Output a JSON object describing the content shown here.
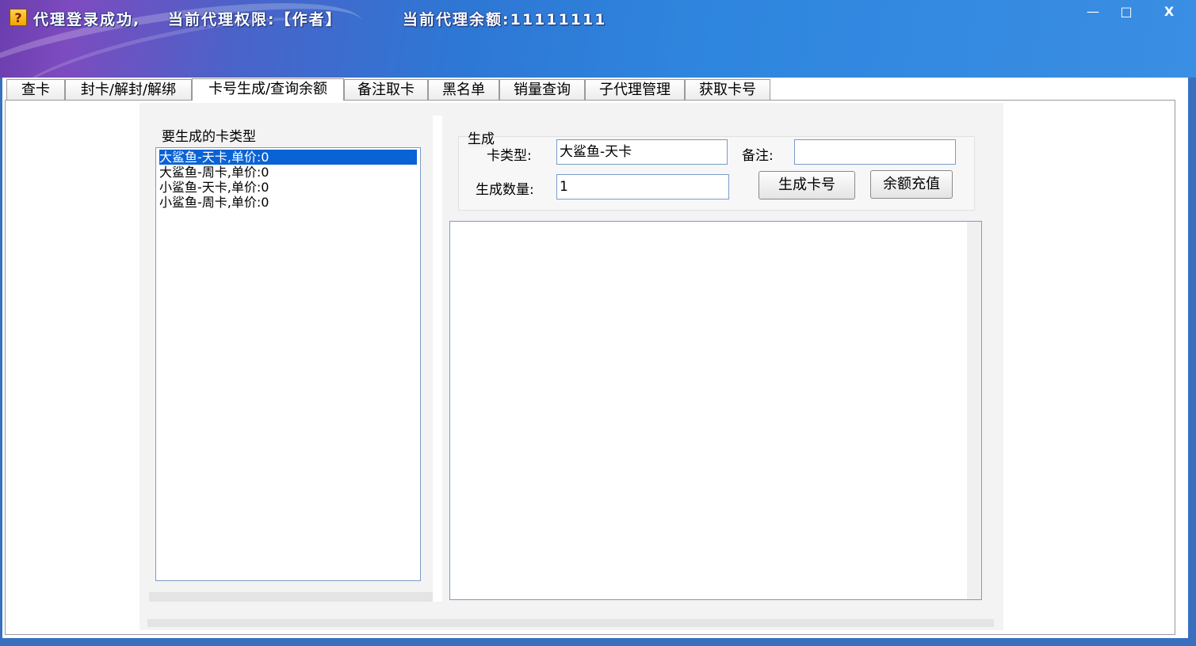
{
  "titlebar": {
    "login_status": "代理登录成功,",
    "permission": "当前代理权限:【作者】",
    "balance": "当前代理余额:11111111",
    "icon": "question-app-icon",
    "icon_glyph": "?",
    "min": "—",
    "max": "□",
    "close": "X"
  },
  "tabs": [
    {
      "label": "查卡"
    },
    {
      "label": "封卡/解封/解绑"
    },
    {
      "label": "卡号生成/查询余额"
    },
    {
      "label": "备注取卡"
    },
    {
      "label": "黑名单"
    },
    {
      "label": "销量查询"
    },
    {
      "label": "子代理管理"
    },
    {
      "label": "获取卡号"
    }
  ],
  "card_types": {
    "label": "要生成的卡类型",
    "items": [
      "大鲨鱼-天卡,单价:0",
      "大鲨鱼-周卡,单价:0",
      "小鲨鱼-天卡,单价:0",
      "小鲨鱼-周卡,单价:0"
    ]
  },
  "generate": {
    "group_label": "生成",
    "card_type_label": "卡类型:",
    "card_type_value": "大鲨鱼-天卡",
    "remark_label": "备注:",
    "remark_value": "",
    "count_label": "生成数量:",
    "count_value": "1",
    "generate_button": "生成卡号",
    "recharge_button": "余额充值"
  },
  "output": {
    "text": ""
  }
}
